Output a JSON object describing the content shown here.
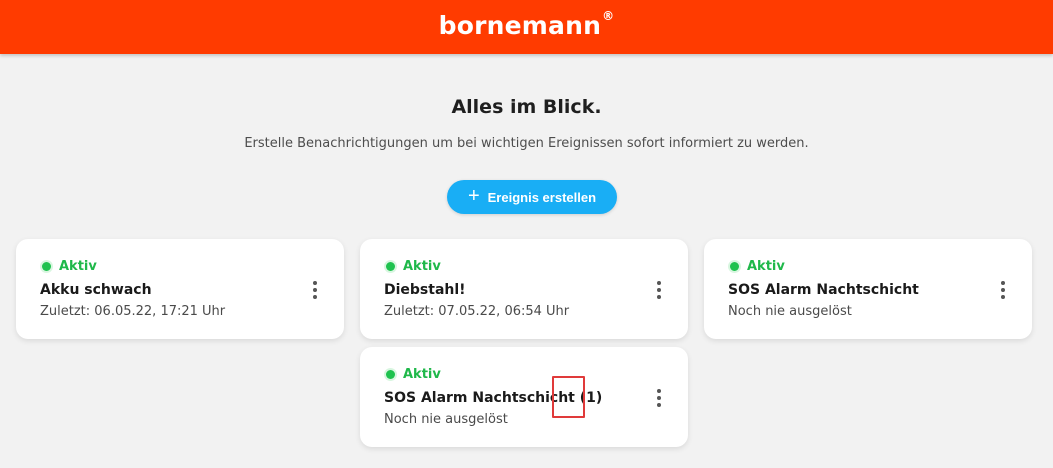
{
  "header": {
    "brand": "bornemann",
    "brand_mark": "®",
    "brand_color": "#ff3b00"
  },
  "main": {
    "title": "Alles im Blick.",
    "subtitle": "Erstelle Benachrichtigungen um bei wichtigen Ereignissen sofort informiert zu werden.",
    "create_button": {
      "icon": "plus-icon",
      "icon_glyph": "+",
      "label": "Ereignis erstellen",
      "color": "#19aef5"
    }
  },
  "events": [
    {
      "status": "Aktiv",
      "name": "Akku schwach",
      "info": "Zuletzt: 06.05.22, 17:21 Uhr"
    },
    {
      "status": "Aktiv",
      "name": "Diebstahl!",
      "info": "Zuletzt: 07.05.22, 06:54 Uhr"
    },
    {
      "status": "Aktiv",
      "name": "SOS Alarm Nachtschicht",
      "info": "Noch nie ausgelöst"
    },
    {
      "status": "Aktiv",
      "name": "SOS Alarm Nachtschicht (1)",
      "info": "Noch nie ausgelöst"
    }
  ],
  "status_color": "#1fb84a"
}
